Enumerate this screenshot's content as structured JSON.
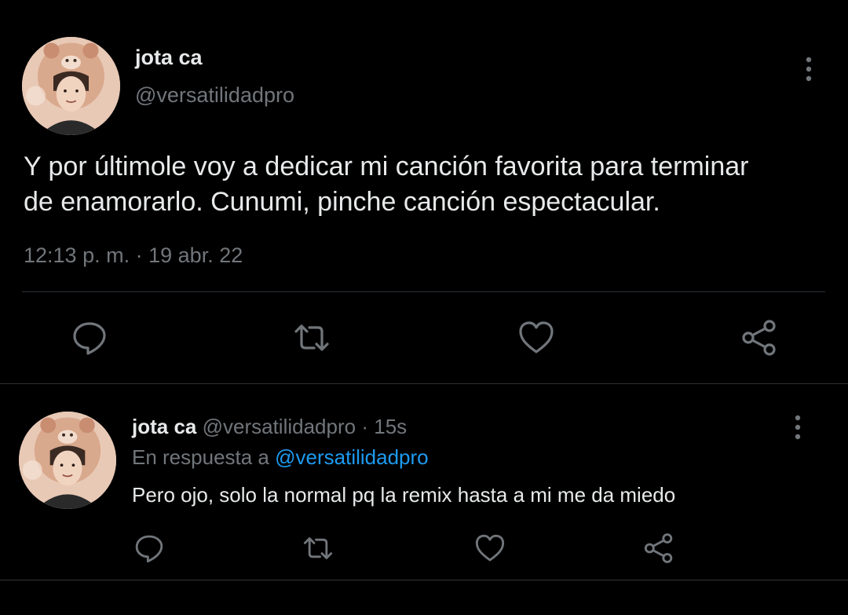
{
  "main_tweet": {
    "author_name": "jota ca",
    "author_handle": "@versatilidadpro",
    "text_line1": "Y por últimole voy a dedicar mi canción favorita para terminar",
    "text_line2": "de enamorarlo. Cunumi, pinche canción espectacular.",
    "time": "12:13 p. m.",
    "separator": "·",
    "date": "19 abr. 22",
    "actions": [
      "reply-icon",
      "retweet-icon",
      "like-icon",
      "share-icon"
    ]
  },
  "reply_tweet": {
    "author_name": "jota ca",
    "author_handle": "@versatilidadpro",
    "separator": "·",
    "relative_time": "15s",
    "reply_prefix": "En respuesta a",
    "reply_target": "@versatilidadpro",
    "text": "Pero ojo, solo la normal pq la remix hasta a mi me da miedo",
    "actions": [
      "reply-icon",
      "retweet-icon",
      "like-icon",
      "share-icon"
    ]
  },
  "colors": {
    "background": "#000000",
    "text_primary": "#e7e9ea",
    "text_secondary": "#71767b",
    "link": "#1d9bf0",
    "divider": "#2f3336"
  }
}
